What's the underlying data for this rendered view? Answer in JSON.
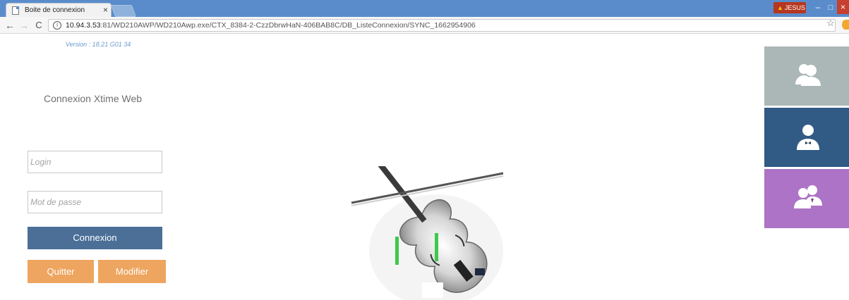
{
  "browser": {
    "tab_title": "Boite de connexion",
    "tab_close": "×",
    "user_badge": "JESUS",
    "url_host": "10.94.3.53",
    "url_rest": ":81/WD210AWP/WD210Awp.exe/CTX_8384-2-CzzDbrwHaN-406BAB8C/DB_ListeConnexion/SYNC_1662954906",
    "nav": {
      "back": "←",
      "forward": "→",
      "reload": "C"
    },
    "window_buttons": {
      "minimize": "–",
      "maximize": "□",
      "close": "×"
    }
  },
  "page": {
    "version": "Version : 18.21 G01 34",
    "title": "Connexion Xtime Web",
    "login_placeholder": "Login",
    "password_placeholder": "Mot de passe",
    "connect_label": "Connexion",
    "quit_label": "Quitter",
    "modify_label": "Modifier"
  },
  "tiles": [
    {
      "icon": "users-icon",
      "color": "#abb6b6"
    },
    {
      "icon": "waiter-icon",
      "color": "#315a84"
    },
    {
      "icon": "user-group-icon",
      "color": "#ad73c6"
    }
  ],
  "colors": {
    "chrome_blue": "#5a8ccb",
    "connect_button": "#4b6f97",
    "orange_buttons": "#eea55f",
    "version_text": "#6b9bd1"
  }
}
